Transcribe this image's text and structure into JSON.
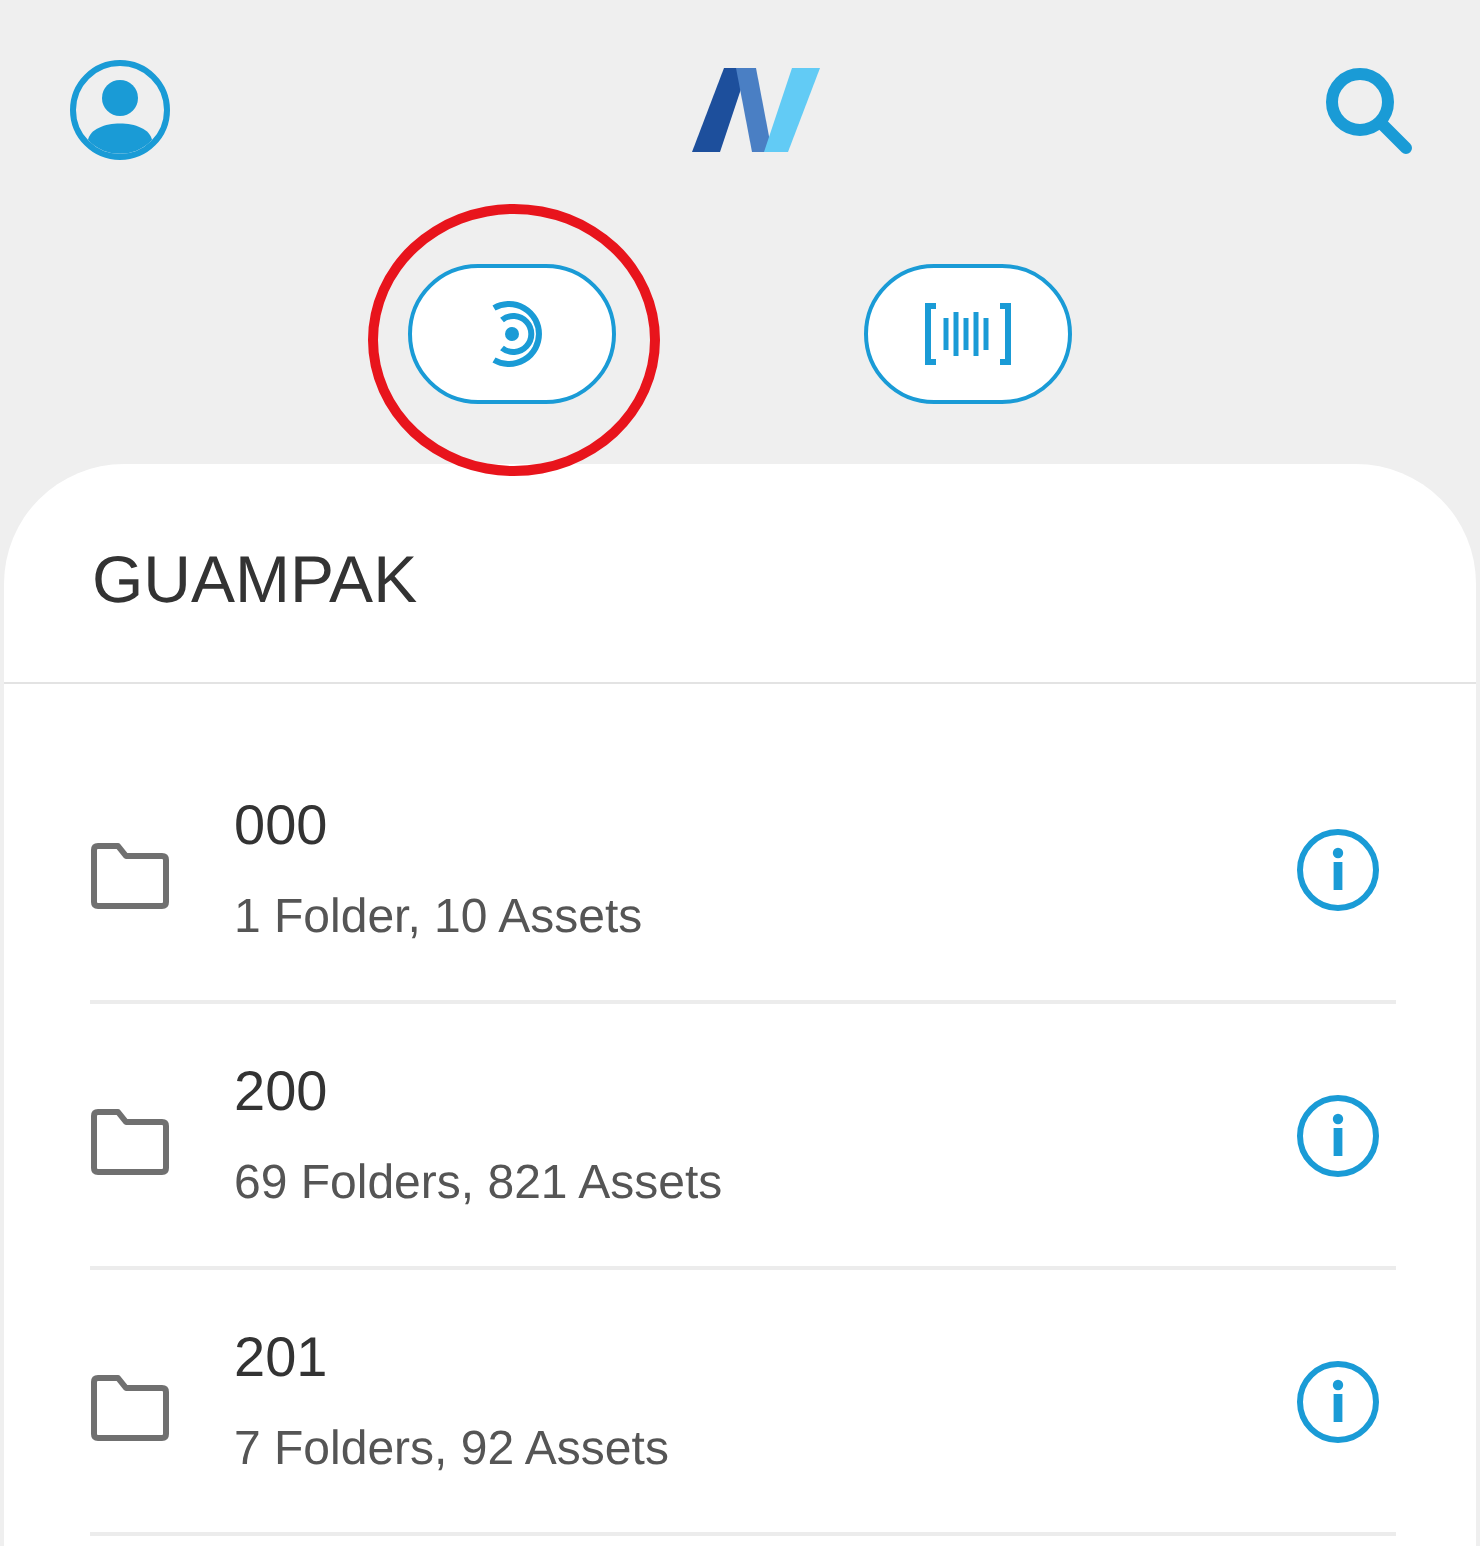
{
  "header": {
    "scan_buttons": [
      {
        "kind": "rfid",
        "highlighted": true
      },
      {
        "kind": "barcode",
        "highlighted": false
      }
    ]
  },
  "location": {
    "title": "GUAMPAK"
  },
  "folders": [
    {
      "name": "000",
      "summary": "1 Folder, 10 Assets"
    },
    {
      "name": "200",
      "summary": "69 Folders, 821 Assets"
    },
    {
      "name": "201",
      "summary": "7 Folders, 92 Assets"
    }
  ]
}
